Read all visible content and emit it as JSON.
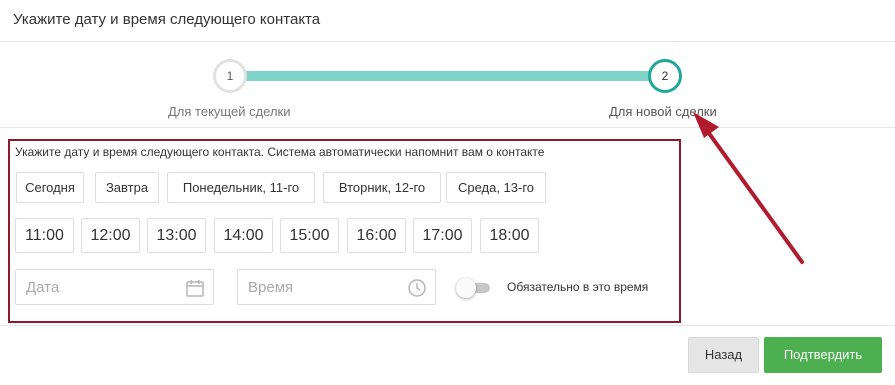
{
  "header": {
    "title": "Укажите дату и время следующего контакта"
  },
  "stepper": {
    "steps": [
      {
        "number": "1",
        "label": "Для текущей сделки"
      },
      {
        "number": "2",
        "label": "Для новой сделки"
      }
    ],
    "progress_color": "#7fd3c9",
    "active_color": "#1fa79a"
  },
  "form": {
    "description": "Укажите дату и время следующего контакта. Система автоматически напомнит вам о контакте",
    "days": [
      "Сегодня",
      "Завтра",
      "Понедельник, 11-го",
      "Вторник, 12-го",
      "Среда, 13-го"
    ],
    "times": [
      "11:00",
      "12:00",
      "13:00",
      "14:00",
      "15:00",
      "16:00",
      "17:00",
      "18:00"
    ],
    "date_placeholder": "Дата",
    "time_placeholder": "Время",
    "date_icon": "calendar-icon",
    "time_icon": "clock-icon",
    "toggle_label": "Обязательно в это время",
    "toggle_on": false,
    "highlight_color": "#8b1a2a"
  },
  "footer": {
    "back_label": "Назад",
    "confirm_label": "Подтвердить",
    "confirm_color": "#4caf50"
  },
  "annotation": {
    "arrow_color": "#b01c2e"
  }
}
